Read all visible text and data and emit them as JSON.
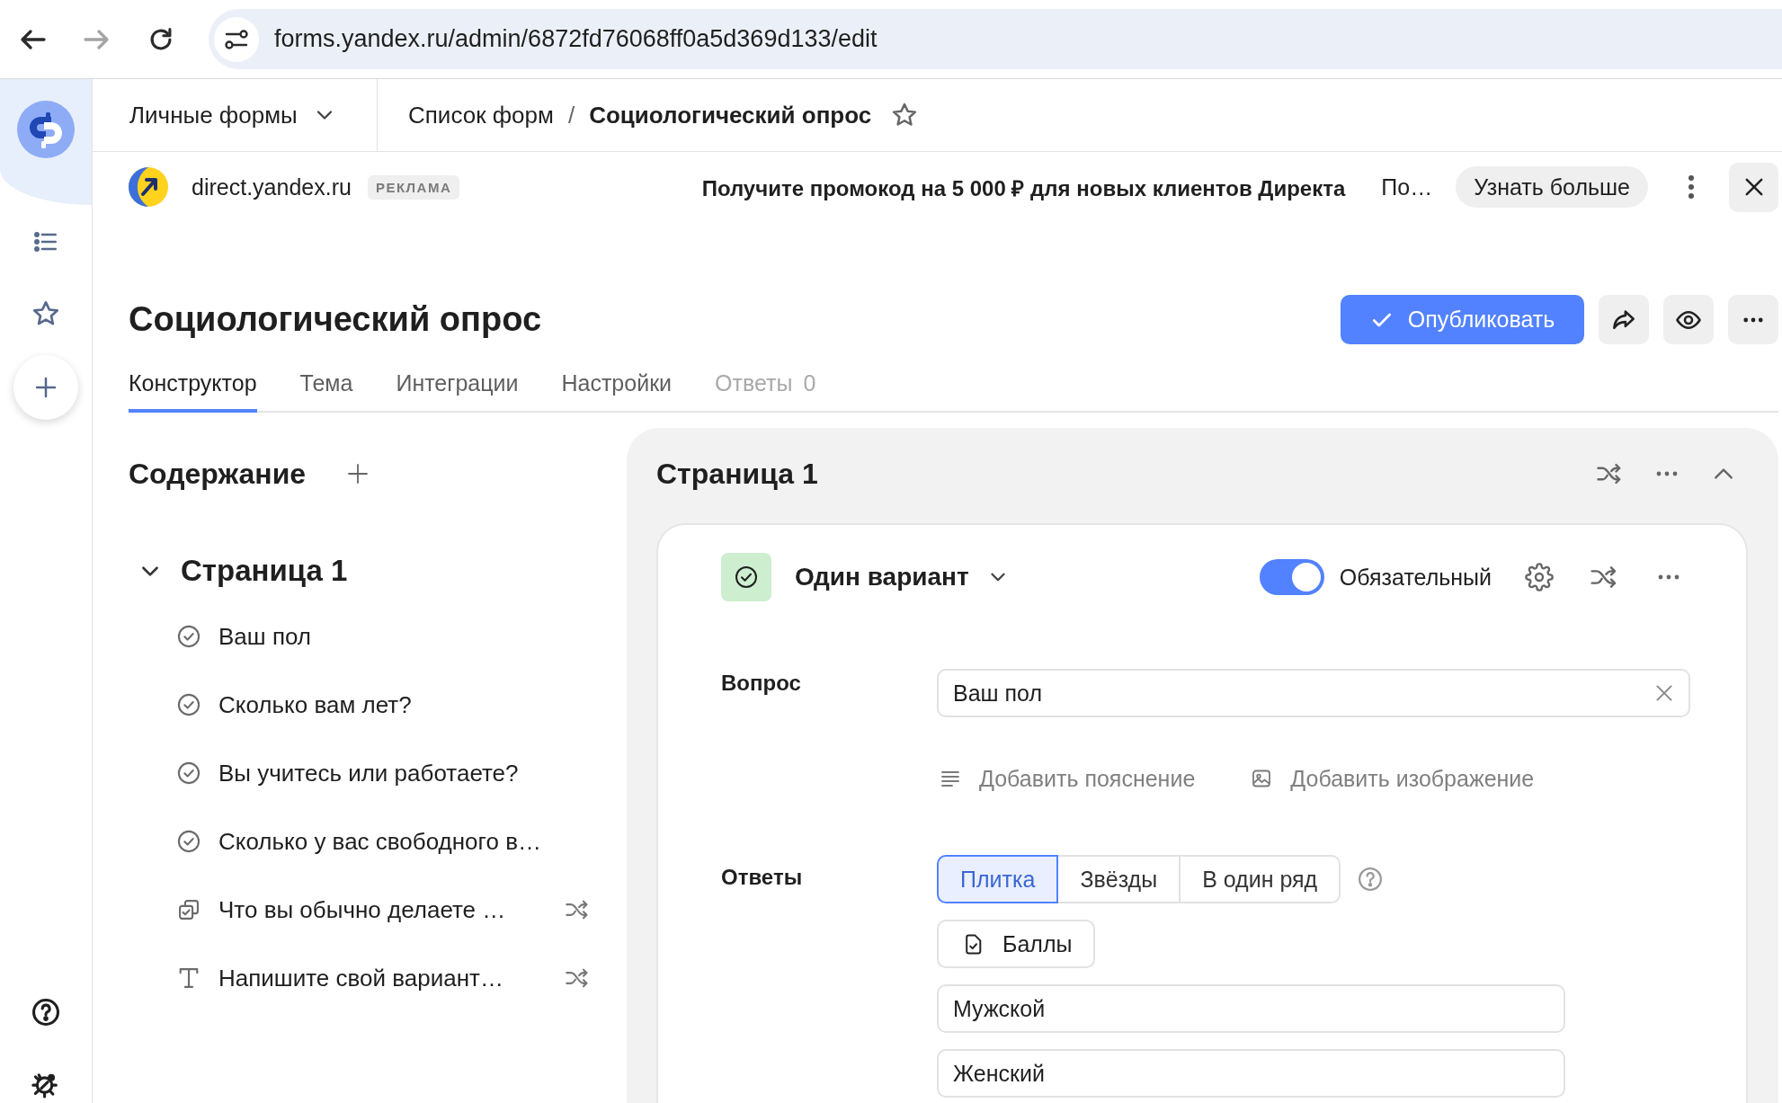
{
  "browser": {
    "url": "forms.yandex.ru/admin/6872fd76068ff0a5d369d133/edit",
    "forward_enabled": false
  },
  "header": {
    "workspace": "Личные формы",
    "breadcrumbs": [
      {
        "label": "Список форм",
        "current": false
      },
      {
        "label": "Социологический опрос",
        "current": true
      }
    ],
    "separator": "/",
    "starred": false
  },
  "ad": {
    "domain": "direct.yandex.ru",
    "badge": "РЕКЛАМА",
    "headline": "Получите промокод на 5 000 ₽ для новых клиентов Директа",
    "teaser": "По…",
    "button": "Узнать больше"
  },
  "form": {
    "title": "Социологический опрос",
    "publish_button": "Опубликовать"
  },
  "tabs": [
    {
      "label": "Конструктор",
      "selected": true,
      "disabled": false
    },
    {
      "label": "Тема",
      "selected": false,
      "disabled": false
    },
    {
      "label": "Интеграции",
      "selected": false,
      "disabled": false
    },
    {
      "label": "Настройки",
      "selected": false,
      "disabled": false
    },
    {
      "label": "Ответы",
      "count": "0",
      "selected": false,
      "disabled": true
    }
  ],
  "contents": {
    "title": "Содержание",
    "pages": [
      {
        "title": "Страница 1",
        "expanded": true,
        "items": [
          {
            "kind": "single",
            "label": "Ваш пол",
            "shuffle": false
          },
          {
            "kind": "single",
            "label": "Сколько вам лет?",
            "shuffle": false
          },
          {
            "kind": "single",
            "label": "Вы учитесь или работаете?",
            "shuffle": false
          },
          {
            "kind": "single",
            "label": "Сколько у вас свободного в…",
            "shuffle": false
          },
          {
            "kind": "multiple",
            "label": "Что вы обычно делаете …",
            "shuffle": true
          },
          {
            "kind": "text",
            "label": "Напишите свой вариант…",
            "shuffle": true
          }
        ]
      }
    ]
  },
  "page": {
    "title": "Страница 1",
    "expanded": true,
    "question": {
      "type": "Один вариант",
      "required": true,
      "required_label": "Обязательный",
      "question_label": "Вопрос",
      "question_value": "Ваш пол",
      "links": [
        {
          "kind": "note",
          "label": "Добавить пояснение"
        },
        {
          "kind": "image",
          "label": "Добавить изображение"
        }
      ],
      "answers_label": "Ответы",
      "views": [
        {
          "label": "Плитка",
          "selected": true
        },
        {
          "label": "Звёзды",
          "selected": false
        },
        {
          "label": "В один ряд",
          "selected": false
        }
      ],
      "score_button": "Баллы",
      "options": [
        {
          "value": "Мужской"
        },
        {
          "value": "Женский"
        }
      ]
    }
  }
}
